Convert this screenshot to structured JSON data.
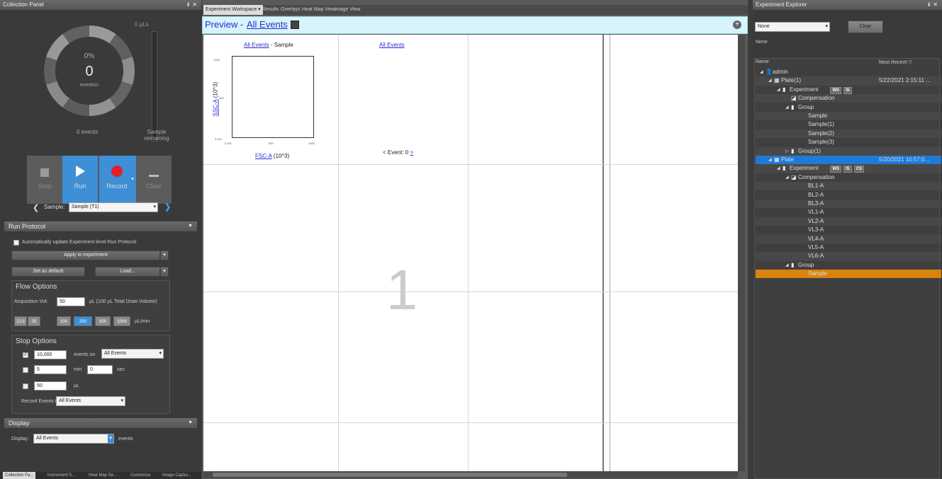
{
  "collection_panel": {
    "title": "Collection Panel",
    "header_controls": "⇟ ✕",
    "volume": "0 µLs",
    "percent": "0%",
    "count": "0",
    "rate_unit": "events/s",
    "events": "0 events",
    "sample_remaining": "Sample remaining",
    "buttons": {
      "stop": "Stop",
      "run": "Run",
      "record": "Record",
      "clear": "Clear"
    },
    "sample_label": "Sample:",
    "sample_value": "Sample (T1)"
  },
  "run_protocol": {
    "title": "Run Protocol",
    "auto_update": "Automatically update Experiment level Run Protocol",
    "apply": "Apply to experiment",
    "set_default": "Set as default",
    "load": "Load...",
    "flow_options": "Flow Options",
    "acq_label": "Acquisition Vol:",
    "acq_value": "50",
    "acq_unit": "µL (100 µL Total Draw Volume)",
    "rates": [
      "12.5",
      "25",
      "100",
      "200",
      "500",
      "1000"
    ],
    "rate_unit": "µL/min",
    "stop_options": "Stop Options",
    "events_value": "10,000",
    "events_on": "events on",
    "events_gate": "All Events",
    "min_value": "5",
    "min_label": "min",
    "sec_value": "0",
    "sec_label": "sec",
    "vol_value": "50",
    "vol_label": "µL",
    "record_label": "Record Events in:",
    "record_value": "All Events"
  },
  "display": {
    "title": "Display",
    "label": "Display:",
    "value": "All Events",
    "unit": "events"
  },
  "bottom_tabs": [
    "Collection Pa...",
    "Instrument S...",
    "Heat Map Se...",
    "Customize",
    "Image Captur..."
  ],
  "workspace": {
    "tabs": [
      "Experiment Workspace ▾",
      "Results",
      "Overlays",
      "Heat Map View",
      "Image View"
    ],
    "preview_label": "Preview -",
    "preview_link": "All Events",
    "plot1": {
      "link": "All Events",
      "suffix": " - Sample",
      "ylabel": "SSC-A",
      "yunit": "(10^3)",
      "xlabel": "FSC-A",
      "xunit": "(10^3)",
      "yticks": [
        "1000",
        "500",
        "0.001"
      ],
      "xticks": [
        "0.001",
        "500",
        "1000"
      ]
    },
    "plot2": {
      "link": "All Events",
      "event_nav": "< Event: 0",
      "next": ">"
    },
    "page_number": "1"
  },
  "explorer": {
    "title": "Experiment Explorer",
    "header_controls": "⇟ ✕",
    "filter_value": "None",
    "clear": "Clear",
    "none_label": "None",
    "col_name": "Name",
    "col_recent": "Most Recent",
    "tree": [
      {
        "label": "admin",
        "icon": "user",
        "level": 0,
        "arrow": "◢"
      },
      {
        "label": "Plate(1)",
        "icon": "plate",
        "level": 1,
        "arrow": "◢",
        "date": "5/22/2021 2:15:11 ..."
      },
      {
        "label": "Experiment",
        "icon": "tube",
        "level": 2,
        "arrow": "◢",
        "badges": [
          "WS",
          "IS"
        ]
      },
      {
        "label": "Compensation",
        "icon": "comp",
        "level": 3,
        "arrow": ""
      },
      {
        "label": "Group",
        "icon": "tube",
        "level": 3,
        "arrow": "◢"
      },
      {
        "label": "Sample",
        "icon": "",
        "level": 5,
        "arrow": ""
      },
      {
        "label": "Sample(1)",
        "icon": "",
        "level": 5,
        "arrow": ""
      },
      {
        "label": "Sample(2)",
        "icon": "",
        "level": 5,
        "arrow": ""
      },
      {
        "label": "Sample(3)",
        "icon": "",
        "level": 5,
        "arrow": ""
      },
      {
        "label": "Group(1)",
        "icon": "tube",
        "level": 3,
        "arrow": "▷"
      },
      {
        "label": "Plate",
        "icon": "plate",
        "level": 1,
        "arrow": "◢",
        "date": "5/20/2021 10:57:0...",
        "selected": "blue"
      },
      {
        "label": "Experiment",
        "icon": "tube",
        "level": 2,
        "arrow": "◢",
        "badges": [
          "WS",
          "IS",
          "CS"
        ]
      },
      {
        "label": "Compensation",
        "icon": "comp",
        "level": 3,
        "arrow": "◢"
      },
      {
        "label": "BL1-A",
        "icon": "",
        "level": 5,
        "arrow": ""
      },
      {
        "label": "BL2-A",
        "icon": "",
        "level": 5,
        "arrow": ""
      },
      {
        "label": "BL3-A",
        "icon": "",
        "level": 5,
        "arrow": ""
      },
      {
        "label": "VL1-A",
        "icon": "",
        "level": 5,
        "arrow": ""
      },
      {
        "label": "VL2-A",
        "icon": "",
        "level": 5,
        "arrow": ""
      },
      {
        "label": "VL3-A",
        "icon": "",
        "level": 5,
        "arrow": ""
      },
      {
        "label": "VL4-A",
        "icon": "",
        "level": 5,
        "arrow": ""
      },
      {
        "label": "VL5-A",
        "icon": "",
        "level": 5,
        "arrow": ""
      },
      {
        "label": "VL6-A",
        "icon": "",
        "level": 5,
        "arrow": ""
      },
      {
        "label": "Group",
        "icon": "tube",
        "level": 3,
        "arrow": "◢"
      },
      {
        "label": "Sample",
        "icon": "",
        "level": 5,
        "arrow": "",
        "selected": "orange"
      }
    ]
  },
  "colors": {
    "run_blue": "#3d8fd6",
    "record_red": "#e0202a",
    "select_blue": "#1f7ad6",
    "select_orange": "#d9830e",
    "preview_bg": "#d7f4fa"
  }
}
